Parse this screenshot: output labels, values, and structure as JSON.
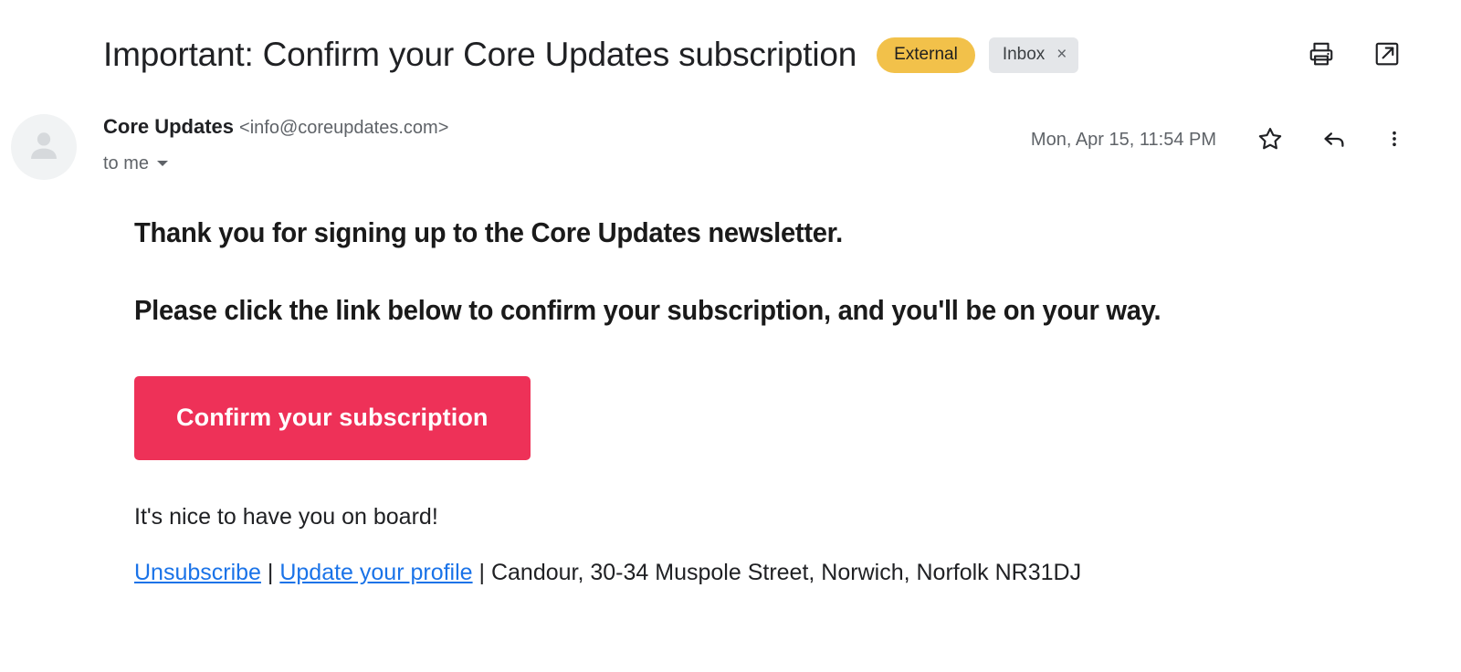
{
  "subject": {
    "title": "Important: Confirm your Core Updates subscription",
    "external_badge": "External",
    "inbox_chip": "Inbox",
    "inbox_chip_close": "×",
    "accent_badge_color": "#F2C14A",
    "chip_color": "#e4e6e9"
  },
  "subject_actions": {
    "print_icon": "print-icon",
    "open_in_new_icon": "open-in-new-icon"
  },
  "sender": {
    "avatar_icon": "person-avatar-icon",
    "name": "Core Updates",
    "email": "<info@coreupdates.com>",
    "recipient": "to me",
    "recipient_caret": "chevron-down-icon",
    "timestamp": "Mon, Apr 15, 11:54 PM"
  },
  "sender_actions": {
    "star_icon": "star-outline-icon",
    "reply_icon": "reply-icon",
    "more_icon": "more-vertical-icon"
  },
  "body": {
    "heading_1": "Thank you for signing up to the Core Updates newsletter.",
    "heading_2": "Please click the link below to confirm your subscription, and you'll be on your way.",
    "cta_label": "Confirm your subscription",
    "cta_color": "#EE3158",
    "closing_text": "It's nice to have you on board!",
    "footer": {
      "unsubscribe_label": "Unsubscribe",
      "separator_1": " | ",
      "update_profile_label": "Update your profile",
      "separator_2": " | ",
      "address": "Candour, 30-34 Muspole Street, Norwich, Norfolk NR31DJ",
      "link_color": "#1a73e8"
    }
  }
}
